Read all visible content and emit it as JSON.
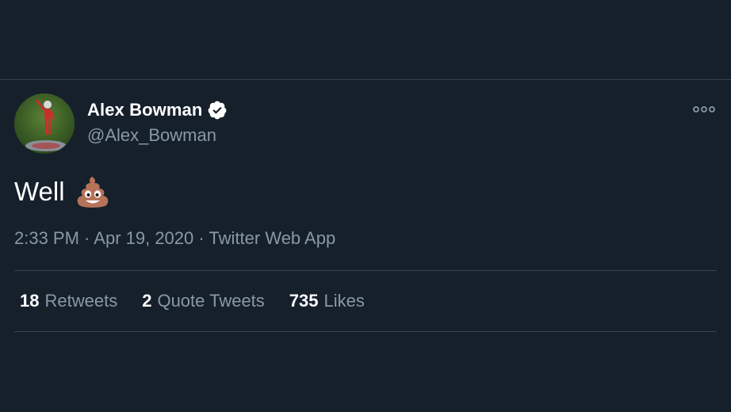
{
  "tweet": {
    "author": {
      "display_name": "Alex Bowman",
      "handle": "@Alex_Bowman",
      "verified": true,
      "verified_icon": "verified-badge-icon",
      "avatar": "profile-photo-avatar"
    },
    "text": "Well",
    "emoji": "pile-of-poo-icon",
    "time": "2:33 PM",
    "date": "Apr 19, 2020",
    "separator": " · ",
    "source": "Twitter Web App",
    "more_icon": "more-options-icon"
  },
  "stats": {
    "retweets_count": "18",
    "retweets_label": "Retweets",
    "quotes_count": "2",
    "quotes_label": "Quote Tweets",
    "likes_count": "735",
    "likes_label": "Likes"
  },
  "colors": {
    "background": "#15202b",
    "divider": "#38444d",
    "secondary_text": "#8899a6",
    "primary_text": "#ffffff"
  }
}
